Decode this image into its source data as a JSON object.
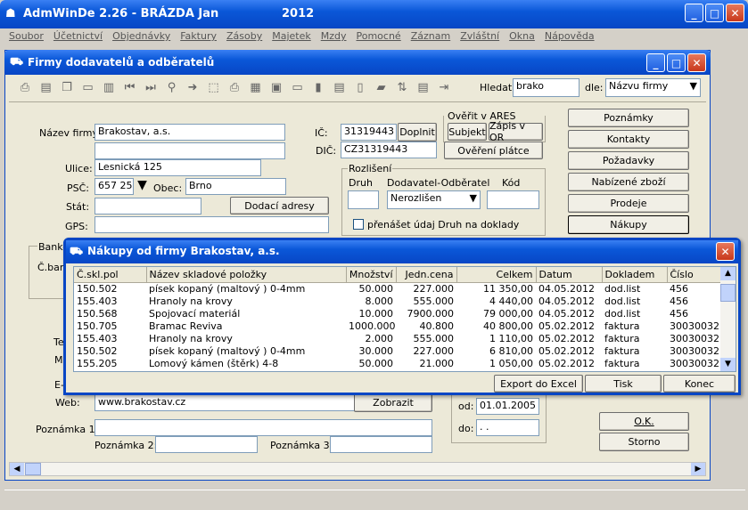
{
  "app": {
    "title": "AdmWinDe 2.26 - BRÁZDA Jan",
    "year": "2012"
  },
  "menu": [
    "Soubor",
    "Účetnictví",
    "Objednávky",
    "Faktury",
    "Zásoby",
    "Majetek",
    "Mzdy",
    "Pomocné",
    "Záznam",
    "Zvláštní",
    "Okna",
    "Nápověda"
  ],
  "child": {
    "title": "Firmy dodavatelů a odběratelů"
  },
  "search": {
    "label": "Hledat:",
    "value": "brako",
    "by_label": "dle:",
    "by_value": "Názvu firmy"
  },
  "form": {
    "name_label": "Název firmy:",
    "name_value": "Brakostav, a.s.",
    "street_label": "Ulice:",
    "street_value": "Lesnická 125",
    "psc_label": "PSČ:",
    "psc_value": "657 25",
    "city_label": "Obec:",
    "city_value": "Brno",
    "state_label": "Stát:",
    "gps_label": "GPS:",
    "ic_label": "IČ:",
    "ic_value": "31319443",
    "dic_label": "DIČ:",
    "dic_value": "CZ31319443",
    "ares_label": "Ověřit v ARES",
    "subjekt": "Subjekt",
    "zapis": "Zápis v OR",
    "doplnit": "Doplnit",
    "overeni": "Ověření plátce",
    "rozliseni_label": "Rozlišení",
    "druh_label": "Druh",
    "dododb_label": "Dodavatel-Odběratel",
    "kod_label": "Kód",
    "dododb_value": "Nerozlišen",
    "prenaset_label": "přenášet údaj Druh na doklady",
    "dodaci_adresy": "Dodací adresy",
    "banka_label": "Banko",
    "cban_label": "Č.ban",
    "te_label": "Te",
    "m_label": "M",
    "e_label": "E-",
    "web_label": "Web:",
    "web_value": "www.brakostav.cz",
    "zobrazit": "Zobrazit",
    "od_label": "od:",
    "od_value": "01.01.2005",
    "do_label": "do:",
    "do_value": ". .",
    "pozn1_label": "Poznámka 1:",
    "pozn2_label": "Poznámka 2:",
    "pozn3_label": "Poznámka 3:"
  },
  "side_buttons": [
    "Poznámky",
    "Kontakty",
    "Požadavky",
    "Nabízené zboží",
    "Prodeje",
    "Nákupy"
  ],
  "ok": "O.K.",
  "storno": "Storno",
  "dialog": {
    "title": "Nákupy od firmy Brakostav, a.s.",
    "columns": [
      "Č.skl.pol",
      "Název skladové položky",
      "Množství",
      "Jedn.cena",
      "Celkem",
      "Datum",
      "Dokladem",
      "Číslo"
    ],
    "rows": [
      [
        "150.502",
        "písek kopaný (maltový ) 0-4mm",
        "50.000",
        "227.000",
        "11 350,00",
        "04.05.2012",
        "dod.list",
        "456"
      ],
      [
        "155.403",
        "Hranoly na krovy",
        "8.000",
        "555.000",
        "4 440,00",
        "04.05.2012",
        "dod.list",
        "456"
      ],
      [
        "150.568",
        "Spojovací materiál",
        "10.000",
        "7900.000",
        "79 000,00",
        "04.05.2012",
        "dod.list",
        "456"
      ],
      [
        "150.705",
        "Bramac Reviva",
        "1000.000",
        "40.800",
        "40 800,00",
        "05.02.2012",
        "faktura",
        "30030032"
      ],
      [
        "155.403",
        "Hranoly na krovy",
        "2.000",
        "555.000",
        "1 110,00",
        "05.02.2012",
        "faktura",
        "30030032"
      ],
      [
        "150.502",
        "písek kopaný (maltový ) 0-4mm",
        "30.000",
        "227.000",
        "6 810,00",
        "05.02.2012",
        "faktura",
        "30030032"
      ],
      [
        "155.205",
        "Lomový kámen (štěrk) 4-8",
        "50.000",
        "21.000",
        "1 050,00",
        "05.02.2012",
        "faktura",
        "30030032"
      ]
    ],
    "export": "Export do Excel",
    "tisk": "Tisk",
    "konec": "Konec"
  }
}
